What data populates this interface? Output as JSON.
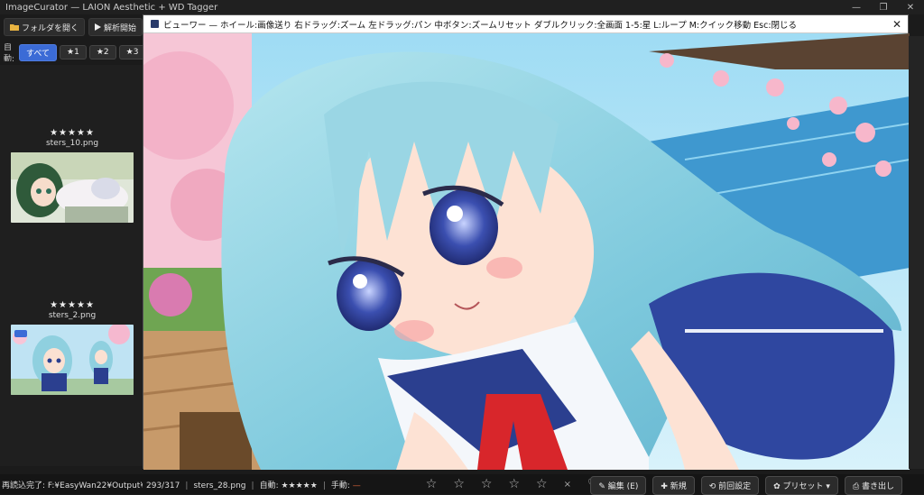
{
  "app": {
    "title": "ImageCurator — LAION Aesthetic + WD Tagger",
    "min": "—",
    "max": "❐",
    "close": "✕"
  },
  "toolbar": {
    "open_folder": "フォルダを開く",
    "start_analysis": "解析開始",
    "folder_icon": "folder-icon",
    "play_icon": "play-icon"
  },
  "filter": {
    "label": "自動:",
    "chips": [
      "すべて",
      "★1",
      "★2",
      "★3"
    ]
  },
  "thumbnails": [
    {
      "stars": "★★★★★",
      "name": "sters_10.png"
    },
    {
      "stars": "★★★★★",
      "name": "sters_2.png"
    }
  ],
  "status": {
    "reload": "再読込完了: F:¥EasyWan22¥Output¥ste",
    "position": "293/317",
    "file": "sters_28.png",
    "auto": "自動: ★★★★★",
    "manual_label": "手動:",
    "manual_value": "—",
    "rating_stars": [
      "☆",
      "☆",
      "☆",
      "☆",
      "☆"
    ],
    "clear": "×",
    "heart": "♡",
    "buttons": {
      "edit": "✎ 編集 (E)",
      "new": "✚ 新規",
      "prev_settings": "⟲ 前回設定",
      "preset": "✿ プリセット ▾",
      "export": "⎙ 書き出し"
    }
  },
  "viewer": {
    "title": "ビューワー — ホイール:画像送り 右ドラッグ:ズーム 左ドラッグ:パン 中ボタン:ズームリセット ダブルクリック:全画面 1-5:星 L:ループ M:クイック移動 Esc:閉じる",
    "close": "✕"
  },
  "colors": {
    "accent": "#3b6bd6",
    "manual_dash": "#e0663a",
    "sky": "#8fd3f0",
    "hair": "#8fd0df",
    "uniform": "#2b3f8f",
    "ribbon": "#d8262b",
    "sakura": "#f3a9c1"
  }
}
